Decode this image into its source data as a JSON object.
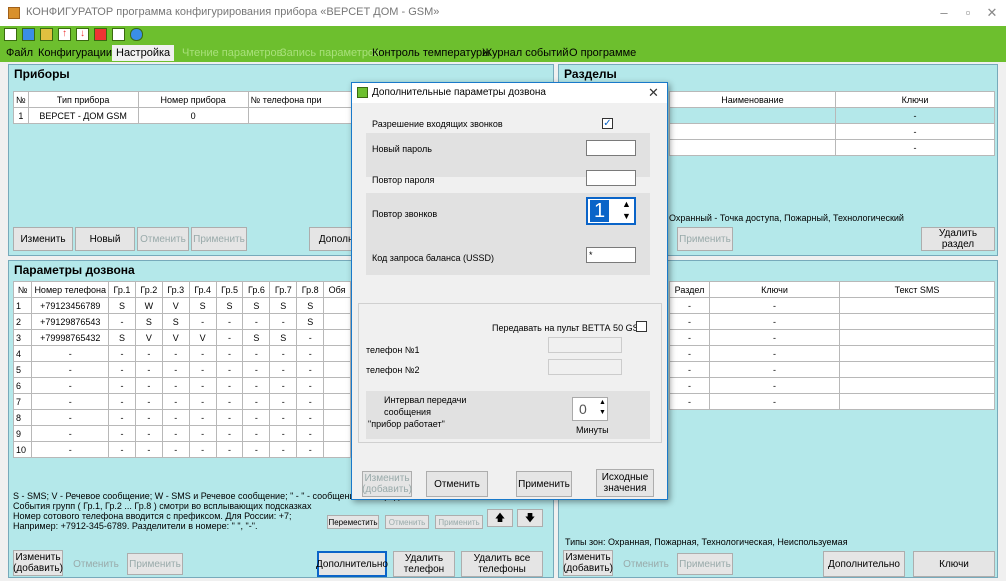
{
  "app": {
    "title": "КОНФИГУРАТОР программа конфигурирования прибора «ВЕРСЕТ ДОМ - GSM»"
  },
  "menu": [
    "Файл",
    "Конфигурации",
    "Настройка",
    "Чтение параметров",
    "Запись параметров",
    "Контроль температуры",
    "Журнал событий",
    "О программе"
  ],
  "devices": {
    "title": "Приборы",
    "headers": [
      "№",
      "Тип прибора",
      "Номер прибора",
      "№ телефона при"
    ],
    "rows": [
      [
        "1",
        "ВЕРСЕТ - ДОМ GSM",
        "0",
        ""
      ]
    ],
    "btn_change": "Изменить",
    "btn_new": "Новый",
    "btn_cancel": "Отменить",
    "btn_apply": "Применить",
    "btn_more": "Дополни"
  },
  "sections": {
    "title": "Разделы",
    "headers": [
      "Наименование",
      "Ключи"
    ],
    "rows": [
      [
        "",
        "-"
      ],
      [
        "",
        "-"
      ],
      [
        "",
        "-"
      ]
    ],
    "zone_text": "Охранный - Точка доступа, Пожарный, Технологический",
    "btn_apply": "Применить",
    "btn_delete": "Удалить раздел"
  },
  "dial": {
    "title": "Параметры дозвона",
    "headers": [
      "№",
      "Номер телефона",
      "Гр.1",
      "Гр.2",
      "Гр.3",
      "Гр.4",
      "Гр.5",
      "Гр.6",
      "Гр.7",
      "Гр.8",
      "Обя"
    ],
    "rows": [
      [
        "1",
        "+79123456789",
        "S",
        "W",
        "V",
        "S",
        "S",
        "S",
        "S",
        "S",
        ""
      ],
      [
        "2",
        "+79129876543",
        "-",
        "S",
        "S",
        "-",
        "-",
        "-",
        "-",
        "S",
        ""
      ],
      [
        "3",
        "+79998765432",
        "S",
        "V",
        "V",
        "V",
        "-",
        "S",
        "S",
        "-",
        ""
      ],
      [
        "4",
        "-",
        "-",
        "-",
        "-",
        "-",
        "-",
        "-",
        "-",
        "-",
        ""
      ],
      [
        "5",
        "-",
        "-",
        "-",
        "-",
        "-",
        "-",
        "-",
        "-",
        "-",
        ""
      ],
      [
        "6",
        "-",
        "-",
        "-",
        "-",
        "-",
        "-",
        "-",
        "-",
        "-",
        ""
      ],
      [
        "7",
        "-",
        "-",
        "-",
        "-",
        "-",
        "-",
        "-",
        "-",
        "-",
        ""
      ],
      [
        "8",
        "-",
        "-",
        "-",
        "-",
        "-",
        "-",
        "-",
        "-",
        "-",
        ""
      ],
      [
        "9",
        "-",
        "-",
        "-",
        "-",
        "-",
        "-",
        "-",
        "-",
        "-",
        ""
      ],
      [
        "10",
        "-",
        "-",
        "-",
        "-",
        "-",
        "-",
        "-",
        "-",
        "-",
        ""
      ]
    ],
    "note1": "S - SMS;  V - Речевое сообщение;  W - SMS и Речевое сообщение; \" - \" - сообщения не передаются",
    "note2": "События групп ( Гр.1, Гр.2 ... Гр.8 ) смотри во всплывающих подсказках",
    "note3": "Номер сотового телефона вводится с префиксом. Для России: +7;",
    "note4": "Например: +7912-345-6789. Разделители в номере: \" \", \"-\".",
    "btn_move": "Переместить",
    "btn_cancel_s": "Отменить",
    "btn_apply_s": "Применить",
    "btn_change_add": "Изменить (добавить)",
    "btn_cancel": "Отменить",
    "btn_apply": "Применить",
    "btn_more": "Дополнительно",
    "btn_delete_phone": "Удалить телефон",
    "btn_delete_all": "Удалить все телефоны"
  },
  "sms": {
    "headers": [
      "Раздел",
      "Ключи",
      "Текст SMS"
    ],
    "rows": [
      [
        "-",
        "-",
        ""
      ],
      [
        "-",
        "-",
        ""
      ],
      [
        "-",
        "-",
        ""
      ],
      [
        "-",
        "-",
        ""
      ],
      [
        "-",
        "-",
        ""
      ],
      [
        "-",
        "-",
        ""
      ],
      [
        "-",
        "-",
        ""
      ]
    ],
    "zone_types": "Типы зон: Охранная, Пожарная, Технологическая, Неиспользуемая",
    "btn_change_add": "Изменить (добавить)",
    "btn_cancel": "Отменить",
    "btn_apply": "Применить",
    "btn_more": "Дополнительно",
    "btn_keys": "Ключи"
  },
  "dialog": {
    "title": "Дополнительные параметры дозвона",
    "allow_incoming": "Разрешение входящих звонков",
    "new_password": "Новый пароль",
    "repeat_password": "Повтор пароля",
    "repeat_calls": "Повтор звонков",
    "repeat_calls_value": "1",
    "ussd_label": "Код запроса баланса (USSD)",
    "ussd_value": "*",
    "betta_label": "Передавать на пульт ВЕТТА 50 GSM",
    "phone1": "телефон №1",
    "phone2": "телефон №2",
    "interval_l1": "Интервал передачи",
    "interval_l2": "сообщения",
    "interval_l3": "\"прибор работает\"",
    "interval_value": "0",
    "minutes": "Минуты",
    "btn_change_add": "Изменить (добавить)",
    "btn_cancel": "Отменить",
    "btn_apply": "Применить",
    "btn_defaults": "Исходные значения"
  }
}
